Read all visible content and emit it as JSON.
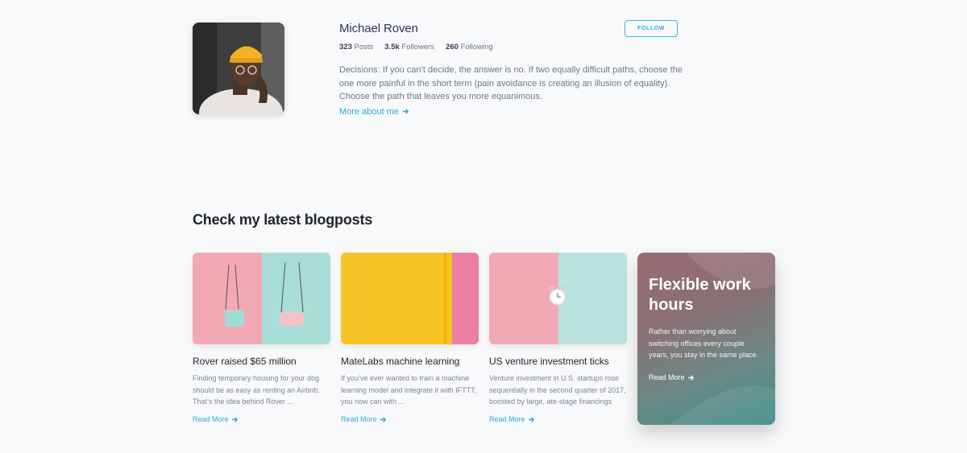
{
  "profile": {
    "name": "Michael Roven",
    "follow_label": "FOLLOW",
    "stats": [
      {
        "value": "323",
        "label": "Posts"
      },
      {
        "value": "3.5k",
        "label": "Followers"
      },
      {
        "value": "260",
        "label": "Following"
      }
    ],
    "bio": "Decisions: If you can’t decide, the answer is no. If two equally difficult paths, choose the one more painful in the short term (pain avoidance is creating an illusion of equality). Choose the path that leaves you more equanimous.",
    "more_link": "More about me"
  },
  "blog": {
    "title": "Check my latest blogposts",
    "posts": [
      {
        "title": "Rover raised $65 million",
        "text": "Finding temporary housing for your dog should be as easy as renting an Airbnb. That’s the idea behind Rover ...",
        "link": "Read More"
      },
      {
        "title": "MateLabs machine learning",
        "text": "If you’ve ever wanted to train a machine learning model and integrate it with IFTTT, you now can with ...",
        "link": "Read More"
      },
      {
        "title": "US venture investment ticks",
        "text": "Venture investment in U.S. startups rose sequentially in the second quarter of 2017, boosted by large, ate-stage financings",
        "link": "Read More"
      }
    ],
    "feature": {
      "title": "Flexible work hours",
      "text": "Rather than worrying about switching offices every couple years, you stay in the same place.",
      "link": "Read More"
    }
  },
  "colors": {
    "accent": "#2fa8d4",
    "background": "#f8f9fb",
    "pink": "#f3a9b4",
    "mint": "#a8ddd8",
    "yellow": "#f6c324"
  },
  "icons": [
    "arrow-right-icon"
  ]
}
